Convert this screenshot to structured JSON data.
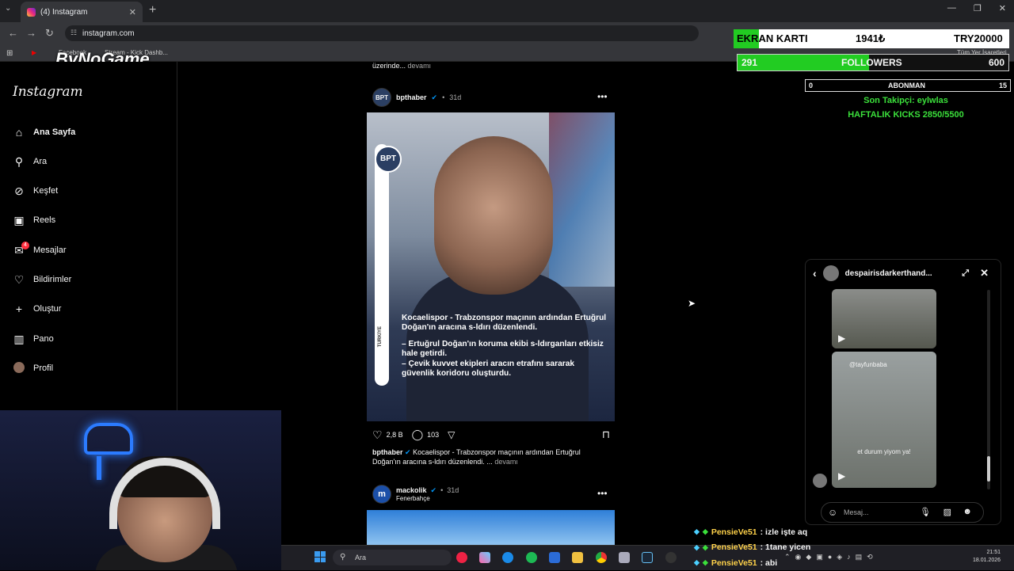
{
  "browser": {
    "tab_title": "(4) Instagram",
    "url": "instagram.com",
    "bookmarks": [
      "Facebook",
      "Stream - Kick Dashb...",
      "Tüm Yer İşaretleri"
    ]
  },
  "watermark": "ByNoGame",
  "instagram": {
    "logo": "Instagram",
    "nav": [
      {
        "label": "Ana Sayfa",
        "icon": "home-icon"
      },
      {
        "label": "Ara",
        "icon": "search-icon"
      },
      {
        "label": "Keşfet",
        "icon": "compass-icon"
      },
      {
        "label": "Reels",
        "icon": "reels-icon"
      },
      {
        "label": "Mesajlar",
        "icon": "messenger-icon",
        "badge": "4"
      },
      {
        "label": "Bildirimler",
        "icon": "heart-icon"
      },
      {
        "label": "Oluştur",
        "icon": "plus-icon"
      },
      {
        "label": "Pano",
        "icon": "dashboard-icon"
      },
      {
        "label": "Profil",
        "icon": "avatar"
      }
    ],
    "prev_caption_tail": "üzerinde...",
    "devami": "devamı",
    "post1": {
      "avatar_text": "BPT",
      "username": "bpthaber",
      "time": "31d",
      "time_sep": "•",
      "image_logo": "BPT",
      "image_side_text": "TÜRKİYE",
      "image_headline": "Kocaelispor - Trabzonspor maçının ardından Ertuğrul Doğan'ın aracına s-ldırı düzenlendi.",
      "image_bullet1": "– Ertuğrul Doğan'ın koruma ekibi s-ldırganları etkisiz hale getirdi.",
      "image_bullet2": "– Çevik kuvvet ekipleri aracın etrafını sararak güvenlik koridoru oluşturdu.",
      "likes": "2,8 B",
      "comments": "103",
      "caption_user": "bpthaber",
      "caption_text": "Kocaelispor - Trabzonspor maçının ardından Ertuğrul Doğan'ın aracına s-ldırı düzenlendi. ...",
      "caption_more": "devamı"
    },
    "post2": {
      "avatar_text": "m",
      "username": "mackolik",
      "time": "31d",
      "subtitle": "Fenerbahçe"
    },
    "chat": {
      "username": "despairisdarkerthand...",
      "reel_user": "@tayfunbaba",
      "reel_caption": "et durum yiyom ya!",
      "placeholder": "Mesaj..."
    }
  },
  "stream_overlay": {
    "kart_label": "EKRAN KARTI",
    "kart_current": "1941₺",
    "kart_goal": "TRY20000",
    "followers_current": "291",
    "followers_label": "FOLLOWERS",
    "followers_goal": "600",
    "followers_progress": 0.485,
    "abone_current": "0",
    "abone_label": "ABONMAN",
    "abone_goal": "15",
    "last_follower": "Son Takipçi: eylwlas",
    "weekly_kicks": "HAFTALIK KICKS 2850/5500",
    "chat": [
      {
        "user": "PensieVe51",
        "msg": ": izle işte aq"
      },
      {
        "user": "PensieVe51",
        "msg": ": 1tane yicen"
      },
      {
        "user": "PensieVe51",
        "msg": ": abi"
      }
    ]
  },
  "taskbar": {
    "search": "Ara",
    "time": "21:51",
    "date": "18.01.2026"
  }
}
